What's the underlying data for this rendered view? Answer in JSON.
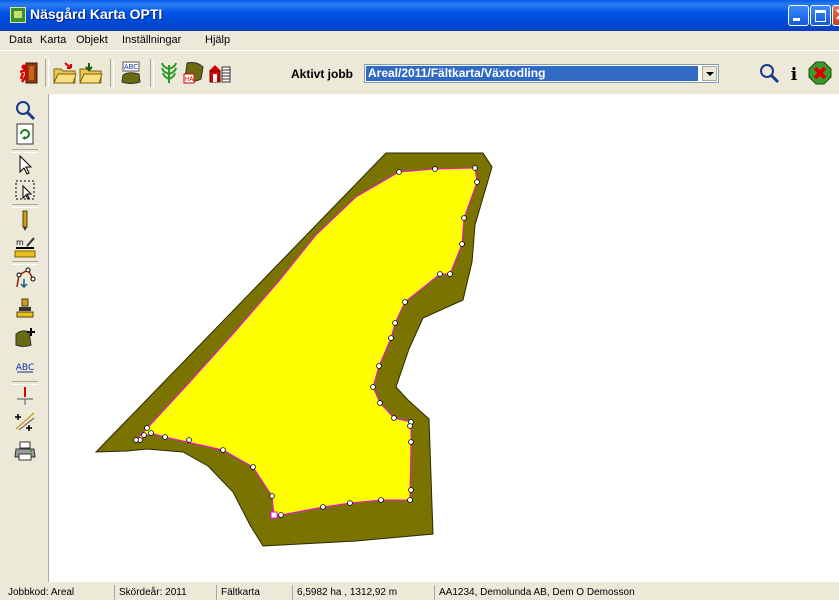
{
  "window": {
    "title": "Näsgård Karta OPTI"
  },
  "menu": [
    "Data",
    "Karta",
    "Objekt",
    "Inställningar",
    "Hjälp"
  ],
  "toolbar": {
    "job_label": "Aktivt jobb",
    "job_value": "Areal/2011/Fältkarta/Växtodling",
    "abc_label": "ABC",
    "ha_label": "HA",
    "info_label": "i"
  },
  "left_toolbar": {
    "abc_label": "ABC",
    "m_label": "m"
  },
  "map": {
    "field_fill": "#ffff00",
    "buffer_fill": "#7a7300",
    "boundary_color": "#ff00ff"
  },
  "status": {
    "jobbkod": "Jobbkod: Areal",
    "skordear": "Skördeår: 2011",
    "kartyp": "Fältkarta",
    "area": "6,5982 ha , 1312,92 m",
    "owner": "AA1234, Demolunda AB, Dem O Demosson"
  }
}
